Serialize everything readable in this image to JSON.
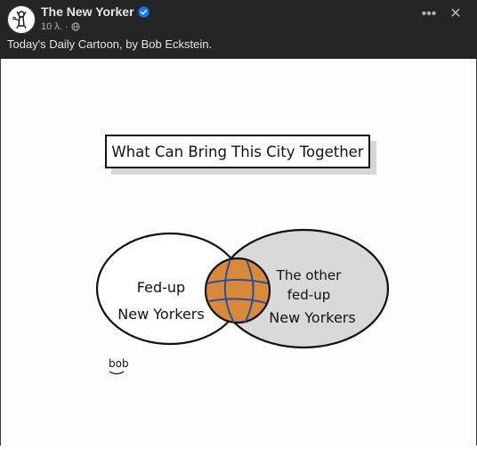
{
  "post": {
    "page_name": "The New Yorker",
    "timestamp": "10 λ.",
    "separator": "·",
    "caption": "Today's Daily Cartoon, by Bob Eckstein.",
    "more_label": "•••",
    "close_label": "✕"
  },
  "cartoon": {
    "title": "What Can Bring This City Together",
    "left_circle": [
      "Fed-up",
      "New Yorkers"
    ],
    "right_circle": [
      "The other",
      "fed-up",
      "New Yorkers"
    ],
    "signature": "bob"
  },
  "icons": {
    "verified": "verified-badge-icon",
    "audience": "globe-icon",
    "more": "more-options-icon",
    "close": "close-icon"
  },
  "colors": {
    "header_bg": "#242526",
    "verified_blue": "#1877f2",
    "basketball_orange": "#d9893a",
    "right_circle_fill": "#d9d9d9"
  }
}
